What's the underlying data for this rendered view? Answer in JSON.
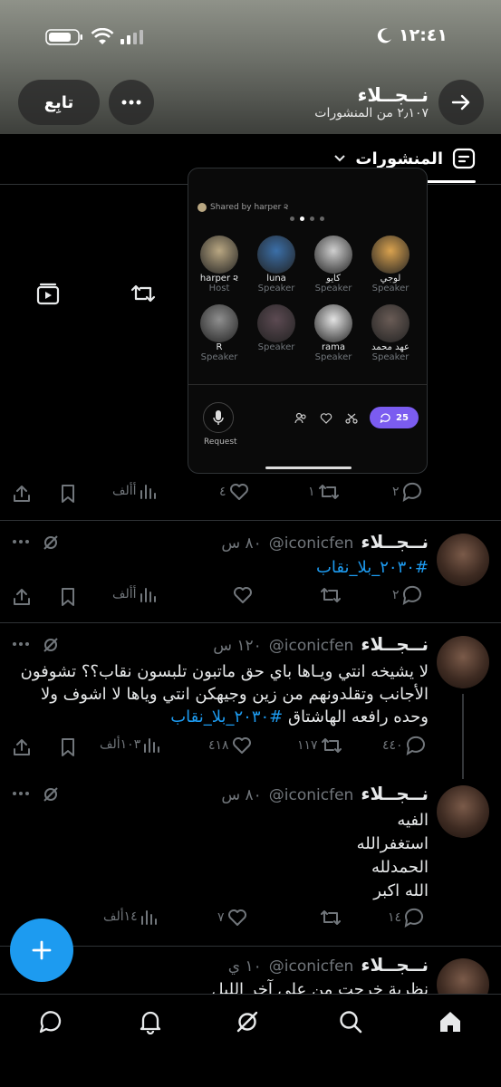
{
  "status_bar": {
    "time": "١٢:٤١"
  },
  "header": {
    "name": "نــجــلاء",
    "subtitle": "٢٫١٠٧ من المنشورات",
    "follow_label": "تابِع"
  },
  "tabs": {
    "active_label": "المنشورات"
  },
  "card": {
    "shared_by": "Shared by harper ૨",
    "request_label": "Request",
    "listener_count": "25",
    "speakers": [
      {
        "name": "لوجي",
        "role": "Speaker",
        "color": "#d9a24f"
      },
      {
        "name": "كايو",
        "role": "Speaker",
        "color": "#cfcfcf"
      },
      {
        "name": "luna",
        "role": "Speaker",
        "color": "#3b6fa8"
      },
      {
        "name": "harper ૨",
        "role": "Host",
        "color": "#b9a782"
      },
      {
        "name": "عهد محمد",
        "role": "Speaker",
        "color": "#6a5c56"
      },
      {
        "name": "rama",
        "role": "Speaker",
        "color": "#e3e3e3"
      },
      {
        "name": "",
        "role": "Speaker",
        "color": "#5c4a52"
      },
      {
        "name": "R",
        "role": "Speaker",
        "color": "#8f8f8f"
      }
    ]
  },
  "tweets": [
    {
      "actions": {
        "views": "أألف",
        "likes": "٤",
        "retweets": "١",
        "replies": "٢"
      }
    },
    {
      "name": "نــجــلاء",
      "handle": "@iconicfen",
      "time": "٨٠ س",
      "text": "",
      "hashtag": "#٢٠٣٠_بلا_نقاب",
      "actions": {
        "views": "أألف",
        "likes": "",
        "retweets": "",
        "replies": "٢"
      }
    },
    {
      "name": "نــجــلاء",
      "handle": "@iconicfen",
      "time": "١٢٠ س",
      "text_lines": [
        "لا يشيخه انتي ويـاها باي حق ماتبون تلبسون نقاب؟؟ تشوفون",
        "الأجانب وتقلدونهم من زين وجيهكن انتي وياها لا اشوف ولا",
        "وحده رافعه الهاشتاق"
      ],
      "hashtag": "#٢٠٣٠_بلا_نقاب",
      "actions": {
        "views": "١٠٣ألف",
        "likes": "٤١٨",
        "retweets": "١١٧",
        "replies": "٤٤٠"
      }
    },
    {
      "name": "نــجــلاء",
      "handle": "@iconicfen",
      "time": "٨٠ س",
      "text_lines": [
        "الفيه",
        "استغفرالله",
        "الحمدلله",
        "الله اكبر"
      ],
      "actions": {
        "views": "١٤ألف",
        "likes": "٧",
        "retweets": "",
        "replies": "١٤"
      }
    },
    {
      "name": "نــجــلاء",
      "handle": "@iconicfen",
      "time": "١٠ ي",
      "text_partial": "نظرية خرجت من علي آخر الليل"
    }
  ],
  "colors": {
    "accent": "#1d9bf0",
    "muted": "#71767b",
    "text": "#e7e9ea",
    "space_purple": "#7b5cf0"
  }
}
